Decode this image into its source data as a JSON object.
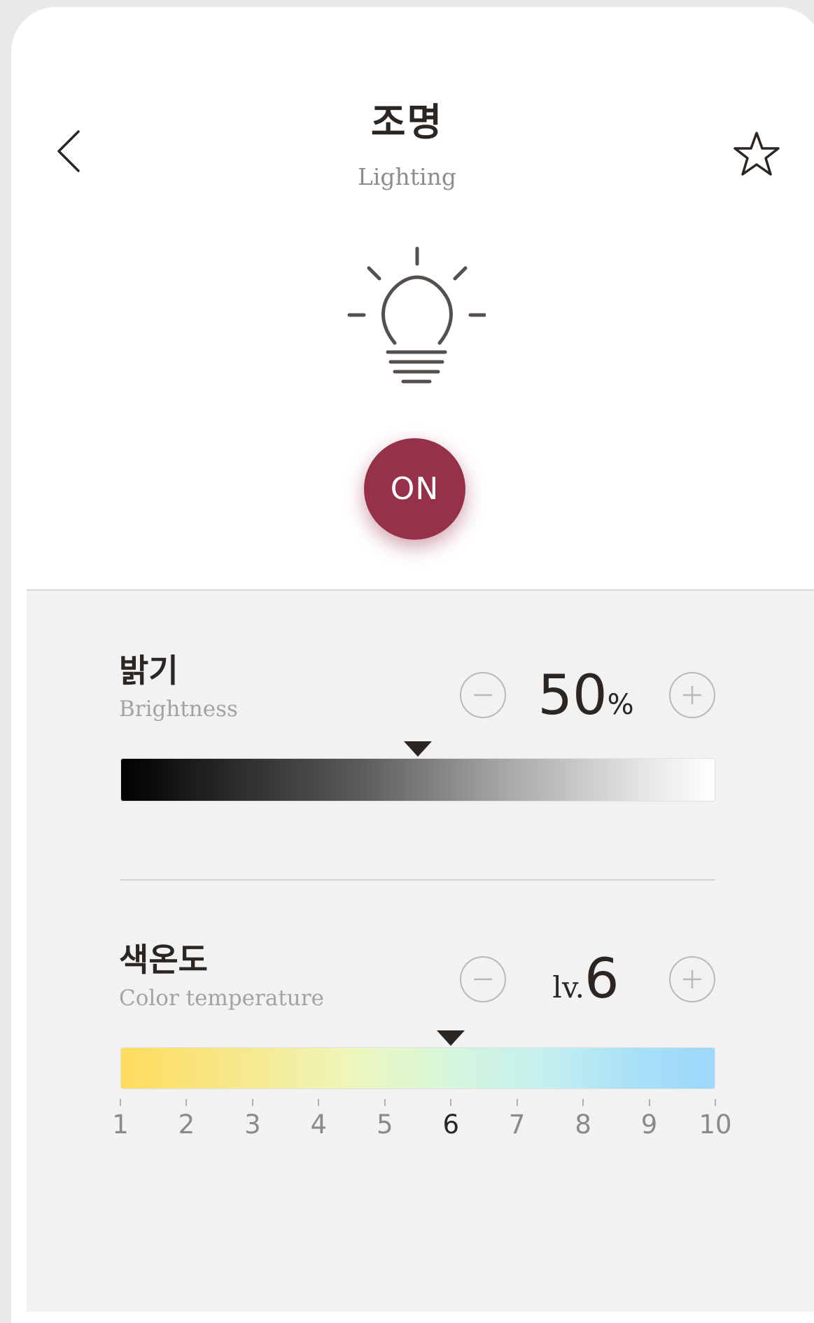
{
  "header": {
    "title": "조명",
    "subtitle": "Lighting",
    "back_icon": "chevron-left-icon",
    "favorite_icon": "star-outline-icon"
  },
  "device": {
    "icon": "light-bulb-icon",
    "power_label": "ON",
    "power_color": "#96314a"
  },
  "brightness": {
    "title": "밝기",
    "subtitle": "Brightness",
    "value": "50",
    "unit": "%",
    "level_fraction": 0.5,
    "decrease_icon": "minus-circle-icon",
    "increase_icon": "plus-circle-icon"
  },
  "color_temperature": {
    "title": "색온도",
    "subtitle": "Color temperature",
    "prefix": "lv.",
    "value": "6",
    "selected_level": 6,
    "scale": [
      "1",
      "2",
      "3",
      "4",
      "5",
      "6",
      "7",
      "8",
      "9",
      "10"
    ],
    "decrease_icon": "minus-circle-icon",
    "increase_icon": "plus-circle-icon"
  }
}
